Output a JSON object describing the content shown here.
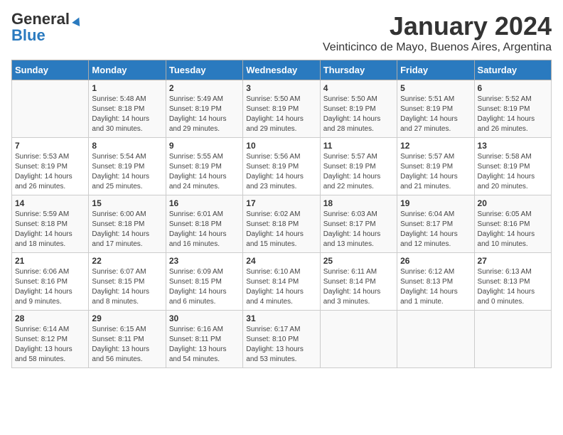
{
  "logo": {
    "general": "General",
    "blue": "Blue"
  },
  "title": "January 2024",
  "location": "Veinticinco de Mayo, Buenos Aires, Argentina",
  "days_of_week": [
    "Sunday",
    "Monday",
    "Tuesday",
    "Wednesday",
    "Thursday",
    "Friday",
    "Saturday"
  ],
  "weeks": [
    [
      {
        "day": null,
        "content": ""
      },
      {
        "day": "1",
        "content": "Sunrise: 5:48 AM\nSunset: 8:18 PM\nDaylight: 14 hours\nand 30 minutes."
      },
      {
        "day": "2",
        "content": "Sunrise: 5:49 AM\nSunset: 8:19 PM\nDaylight: 14 hours\nand 29 minutes."
      },
      {
        "day": "3",
        "content": "Sunrise: 5:50 AM\nSunset: 8:19 PM\nDaylight: 14 hours\nand 29 minutes."
      },
      {
        "day": "4",
        "content": "Sunrise: 5:50 AM\nSunset: 8:19 PM\nDaylight: 14 hours\nand 28 minutes."
      },
      {
        "day": "5",
        "content": "Sunrise: 5:51 AM\nSunset: 8:19 PM\nDaylight: 14 hours\nand 27 minutes."
      },
      {
        "day": "6",
        "content": "Sunrise: 5:52 AM\nSunset: 8:19 PM\nDaylight: 14 hours\nand 26 minutes."
      }
    ],
    [
      {
        "day": "7",
        "content": "Sunrise: 5:53 AM\nSunset: 8:19 PM\nDaylight: 14 hours\nand 26 minutes."
      },
      {
        "day": "8",
        "content": "Sunrise: 5:54 AM\nSunset: 8:19 PM\nDaylight: 14 hours\nand 25 minutes."
      },
      {
        "day": "9",
        "content": "Sunrise: 5:55 AM\nSunset: 8:19 PM\nDaylight: 14 hours\nand 24 minutes."
      },
      {
        "day": "10",
        "content": "Sunrise: 5:56 AM\nSunset: 8:19 PM\nDaylight: 14 hours\nand 23 minutes."
      },
      {
        "day": "11",
        "content": "Sunrise: 5:57 AM\nSunset: 8:19 PM\nDaylight: 14 hours\nand 22 minutes."
      },
      {
        "day": "12",
        "content": "Sunrise: 5:57 AM\nSunset: 8:19 PM\nDaylight: 14 hours\nand 21 minutes."
      },
      {
        "day": "13",
        "content": "Sunrise: 5:58 AM\nSunset: 8:19 PM\nDaylight: 14 hours\nand 20 minutes."
      }
    ],
    [
      {
        "day": "14",
        "content": "Sunrise: 5:59 AM\nSunset: 8:18 PM\nDaylight: 14 hours\nand 18 minutes."
      },
      {
        "day": "15",
        "content": "Sunrise: 6:00 AM\nSunset: 8:18 PM\nDaylight: 14 hours\nand 17 minutes."
      },
      {
        "day": "16",
        "content": "Sunrise: 6:01 AM\nSunset: 8:18 PM\nDaylight: 14 hours\nand 16 minutes."
      },
      {
        "day": "17",
        "content": "Sunrise: 6:02 AM\nSunset: 8:18 PM\nDaylight: 14 hours\nand 15 minutes."
      },
      {
        "day": "18",
        "content": "Sunrise: 6:03 AM\nSunset: 8:17 PM\nDaylight: 14 hours\nand 13 minutes."
      },
      {
        "day": "19",
        "content": "Sunrise: 6:04 AM\nSunset: 8:17 PM\nDaylight: 14 hours\nand 12 minutes."
      },
      {
        "day": "20",
        "content": "Sunrise: 6:05 AM\nSunset: 8:16 PM\nDaylight: 14 hours\nand 10 minutes."
      }
    ],
    [
      {
        "day": "21",
        "content": "Sunrise: 6:06 AM\nSunset: 8:16 PM\nDaylight: 14 hours\nand 9 minutes."
      },
      {
        "day": "22",
        "content": "Sunrise: 6:07 AM\nSunset: 8:15 PM\nDaylight: 14 hours\nand 8 minutes."
      },
      {
        "day": "23",
        "content": "Sunrise: 6:09 AM\nSunset: 8:15 PM\nDaylight: 14 hours\nand 6 minutes."
      },
      {
        "day": "24",
        "content": "Sunrise: 6:10 AM\nSunset: 8:14 PM\nDaylight: 14 hours\nand 4 minutes."
      },
      {
        "day": "25",
        "content": "Sunrise: 6:11 AM\nSunset: 8:14 PM\nDaylight: 14 hours\nand 3 minutes."
      },
      {
        "day": "26",
        "content": "Sunrise: 6:12 AM\nSunset: 8:13 PM\nDaylight: 14 hours\nand 1 minute."
      },
      {
        "day": "27",
        "content": "Sunrise: 6:13 AM\nSunset: 8:13 PM\nDaylight: 14 hours\nand 0 minutes."
      }
    ],
    [
      {
        "day": "28",
        "content": "Sunrise: 6:14 AM\nSunset: 8:12 PM\nDaylight: 13 hours\nand 58 minutes."
      },
      {
        "day": "29",
        "content": "Sunrise: 6:15 AM\nSunset: 8:11 PM\nDaylight: 13 hours\nand 56 minutes."
      },
      {
        "day": "30",
        "content": "Sunrise: 6:16 AM\nSunset: 8:11 PM\nDaylight: 13 hours\nand 54 minutes."
      },
      {
        "day": "31",
        "content": "Sunrise: 6:17 AM\nSunset: 8:10 PM\nDaylight: 13 hours\nand 53 minutes."
      },
      {
        "day": null,
        "content": ""
      },
      {
        "day": null,
        "content": ""
      },
      {
        "day": null,
        "content": ""
      }
    ]
  ]
}
